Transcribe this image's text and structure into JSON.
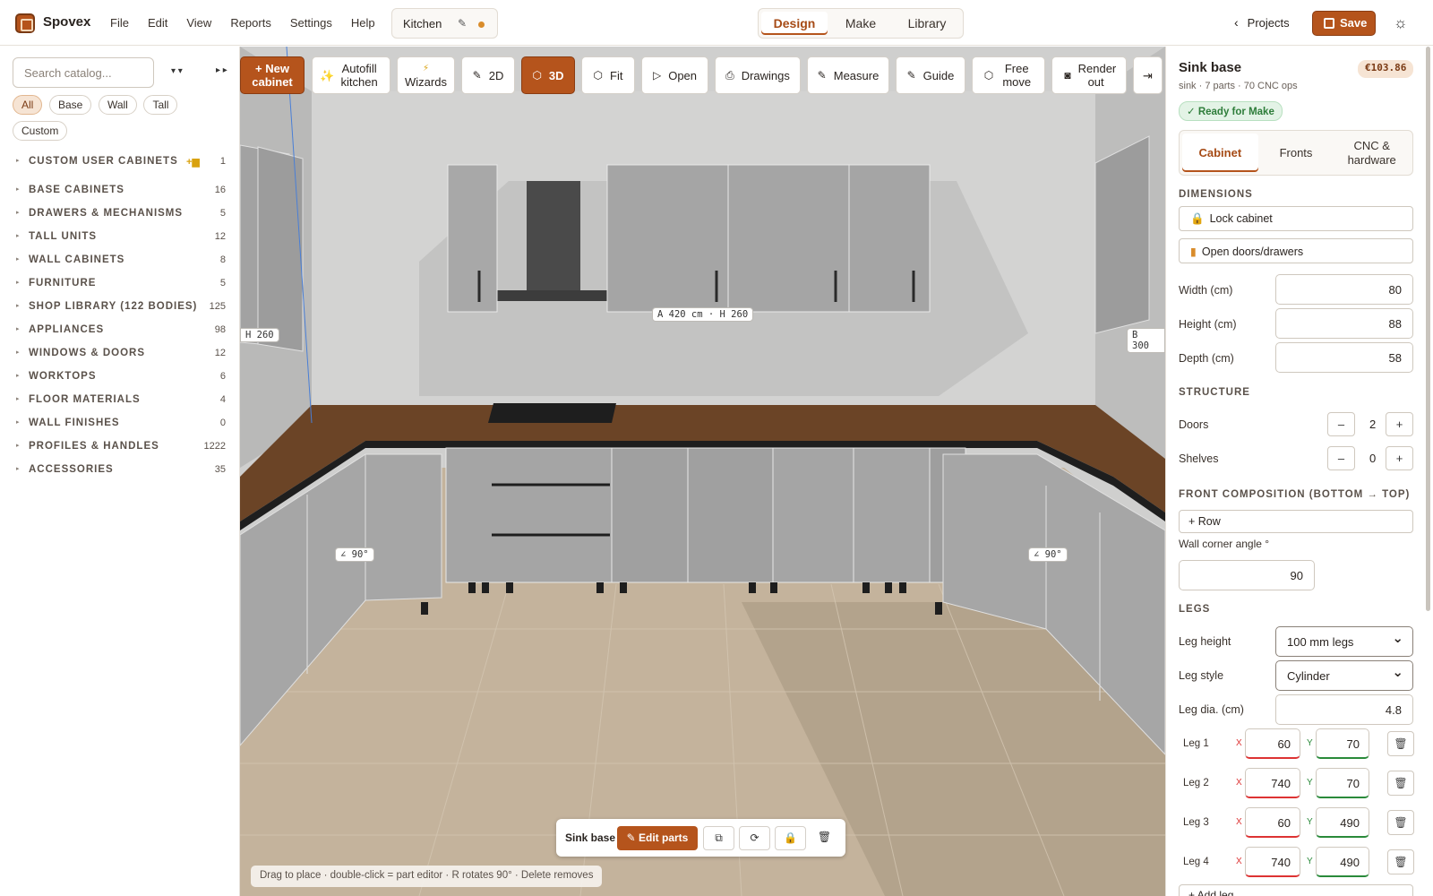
{
  "app": {
    "name": "Spovex"
  },
  "menu": [
    "File",
    "Edit",
    "View",
    "Reports",
    "Settings",
    "Help"
  ],
  "project": {
    "name": "Kitchen",
    "unsaved": true
  },
  "modes": {
    "items": [
      "Design",
      "Make",
      "Library"
    ],
    "active": "Design"
  },
  "header": {
    "projects_label": "Projects",
    "save_label": "Save",
    "theme_icon": "sun-icon"
  },
  "catalog": {
    "search_placeholder": "Search catalog...",
    "sort_label": "▾ ▾",
    "collapse_label": "▸ ▸",
    "filters": [
      "All",
      "Base",
      "Wall",
      "Tall",
      "Custom"
    ],
    "active_filter": "All",
    "categories": [
      {
        "label": "CUSTOM USER CABINETS",
        "count": "1"
      },
      {
        "label": "BASE CABINETS",
        "count": "16"
      },
      {
        "label": "DRAWERS & MECHANISMS",
        "count": "5"
      },
      {
        "label": "TALL UNITS",
        "count": "12"
      },
      {
        "label": "WALL CABINETS",
        "count": "8"
      },
      {
        "label": "FURNITURE",
        "count": "5"
      },
      {
        "label": "SHOP LIBRARY (122 BODIES)",
        "count": "125"
      },
      {
        "label": "APPLIANCES",
        "count": "98"
      },
      {
        "label": "WINDOWS & DOORS",
        "count": "12"
      },
      {
        "label": "WORKTOPS",
        "count": "6"
      },
      {
        "label": "FLOOR MATERIALS",
        "count": "4"
      },
      {
        "label": "WALL FINISHES",
        "count": "0"
      },
      {
        "label": "PROFILES & HANDLES",
        "count": "1222"
      },
      {
        "label": "ACCESSORIES",
        "count": "35"
      }
    ]
  },
  "toolbar": {
    "new_cabinet": "+ New cabinet",
    "autofill": "Autofill kitchen",
    "wizards": "Wizards",
    "view2d": "2D",
    "view3d": "3D",
    "fit": "Fit",
    "open": "Open",
    "drawings": "Drawings",
    "measure": "Measure",
    "guide": "Guide",
    "free_move": "Free move",
    "render": "Render out",
    "collapse": "⇥"
  },
  "viewport": {
    "dims": {
      "center": "A 420 cm · H 260",
      "left_h": "H 260",
      "right_b": "B 300",
      "left_angle": "∠ 90°",
      "right_angle": "∠ 90°"
    },
    "selection": {
      "name": "Sink base",
      "edit_parts": "✎ Edit parts"
    },
    "hint": "Drag to place · double-click = part editor · R rotates 90° · Delete removes"
  },
  "inspector": {
    "title": "Sink base",
    "price": "€103.86",
    "subtitle": "sink · 7 parts · 70 CNC ops",
    "status": "✓ Ready for Make",
    "tabs": [
      "Cabinet",
      "Fronts",
      "CNC & hardware"
    ],
    "active_tab": "Cabinet",
    "dimensions_heading": "DIMENSIONS",
    "lock_cabinet": "Lock cabinet",
    "open_doors": "Open doors/drawers",
    "width_label": "Width (cm)",
    "width": "80",
    "height_label": "Height (cm)",
    "height": "88",
    "depth_label": "Depth (cm)",
    "depth": "58",
    "structure_heading": "STRUCTURE",
    "doors_label": "Doors",
    "doors": "2",
    "shelves_label": "Shelves",
    "shelves": "0",
    "front_heading": "FRONT COMPOSITION (BOTTOM → TOP)",
    "add_row": "+ Row",
    "corner_label": "Wall corner angle °",
    "corner": "90",
    "legs_heading": "LEGS",
    "leg_height_label": "Leg height",
    "leg_height": "100 mm legs",
    "leg_style_label": "Leg style",
    "leg_style": "Cylinder",
    "leg_dia_label": "Leg dia. (cm)",
    "leg_dia": "4.8",
    "legs": [
      {
        "name": "Leg 1",
        "x": "60",
        "y": "70"
      },
      {
        "name": "Leg 2",
        "x": "740",
        "y": "70"
      },
      {
        "name": "Leg 3",
        "x": "60",
        "y": "490"
      },
      {
        "name": "Leg 4",
        "x": "740",
        "y": "490"
      }
    ],
    "add_leg": "+ Add leg"
  },
  "colors": {
    "accent": "#b5541c",
    "worktop": "#6b4426",
    "cabinet": "#a9a9a9",
    "floor": "#c4b39c"
  }
}
